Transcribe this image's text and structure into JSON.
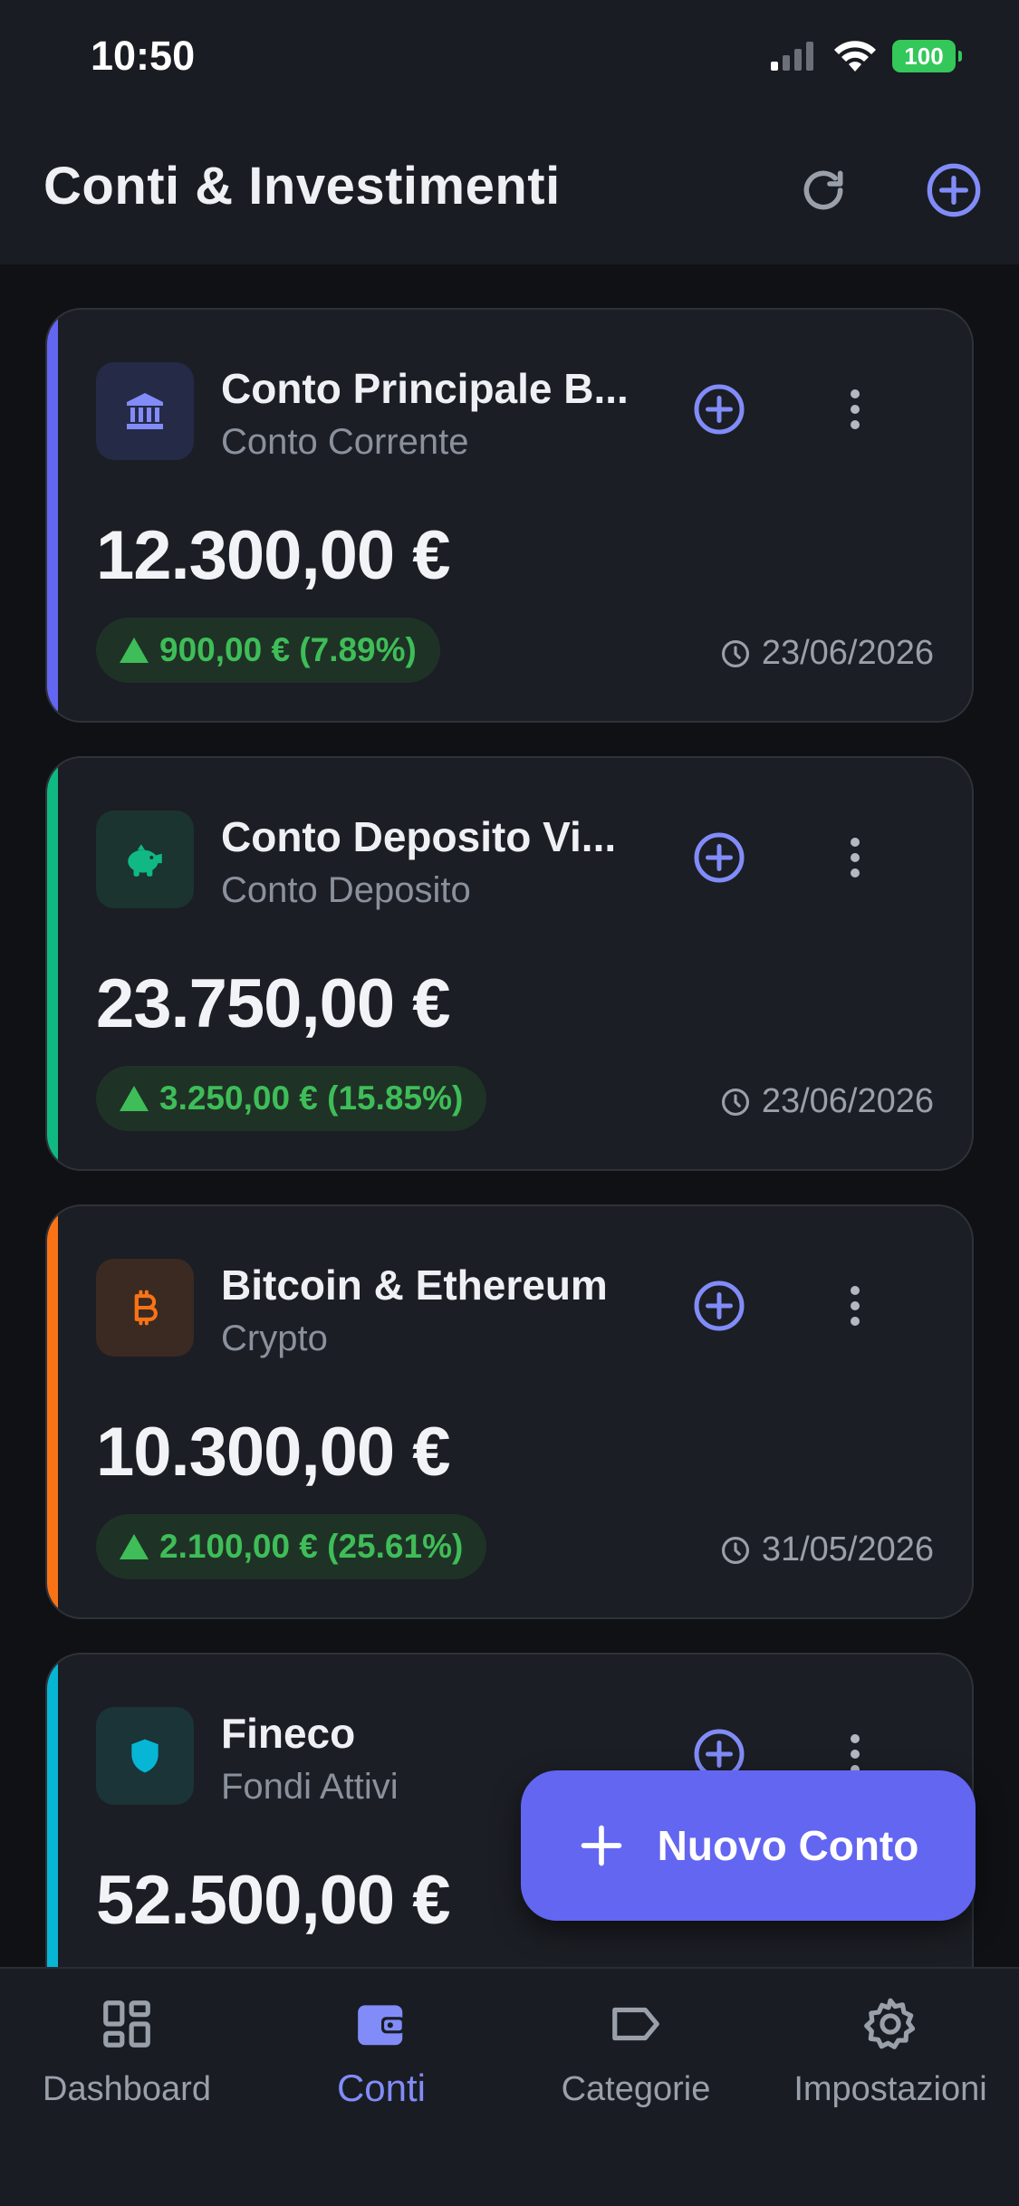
{
  "status_bar": {
    "time": "10:50",
    "battery": "100"
  },
  "header": {
    "title": "Conti & Investimenti"
  },
  "accounts": [
    {
      "name": "Conto Principale B...",
      "type": "Conto Corrente",
      "balance": "12.300,00 €",
      "gain": "900,00 € (7.89%)",
      "updated": "23/06/2026",
      "accent": "#6366f1",
      "icon": "bank-icon",
      "icon_bg": "#252a47",
      "icon_color": "#818cf8"
    },
    {
      "name": "Conto Deposito Vi...",
      "type": "Conto Deposito",
      "balance": "23.750,00 €",
      "gain": "3.250,00 € (15.85%)",
      "updated": "23/06/2026",
      "accent": "#10b981",
      "icon": "piggy-bank-icon",
      "icon_bg": "#1b3430",
      "icon_color": "#10b981"
    },
    {
      "name": "Bitcoin & Ethereum",
      "type": "Crypto",
      "balance": "10.300,00 €",
      "gain": "2.100,00 € (25.61%)",
      "updated": "31/05/2026",
      "accent": "#f97316",
      "icon": "bitcoin-icon",
      "icon_bg": "#3a2a22",
      "icon_color": "#f97316"
    },
    {
      "name": "Fineco",
      "type": "Fondi Attivi",
      "balance": "52.500,00 €",
      "gain": "",
      "updated": "",
      "accent": "#06b6d4",
      "icon": "shield-icon",
      "icon_bg": "#1a3438",
      "icon_color": "#06b6d4"
    }
  ],
  "fab": {
    "label": "Nuovo Conto"
  },
  "nav": [
    {
      "label": "Dashboard",
      "icon": "dashboard-icon"
    },
    {
      "label": "Conti",
      "icon": "wallet-icon",
      "active": true
    },
    {
      "label": "Categorie",
      "icon": "tag-icon"
    },
    {
      "label": "Impostazioni",
      "icon": "gear-icon"
    }
  ],
  "colors": {
    "primary": "#6366f1",
    "gain": "#3fbd58",
    "background": "#0f1115",
    "card": "#1b1e24"
  }
}
